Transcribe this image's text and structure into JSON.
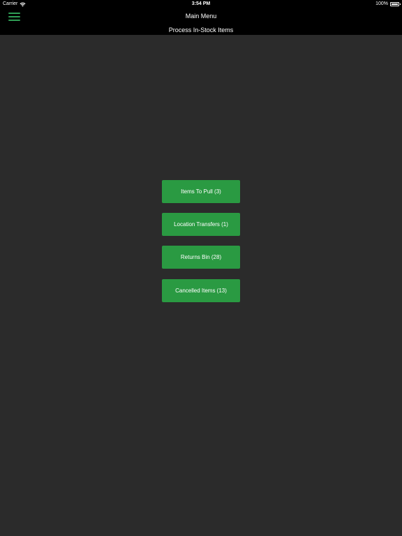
{
  "status_bar": {
    "carrier": "Carrier",
    "time": "3:54 PM",
    "battery": "100%",
    "battery_level": 1.0
  },
  "header": {
    "menu_icon": "hamburger-menu-icon",
    "title": "Main Menu",
    "subtitle": "Process In-Stock Items"
  },
  "colors": {
    "background": "#2b2b2b",
    "header_background": "#000000",
    "accent": "#2f9e55",
    "button": "#2a9a42"
  },
  "buttons": [
    {
      "label": "Items To Pull (3)"
    },
    {
      "label": "Location Transfers (1)"
    },
    {
      "label": "Returns Bin (28)"
    },
    {
      "label": "Cancelled Items (13)"
    }
  ]
}
